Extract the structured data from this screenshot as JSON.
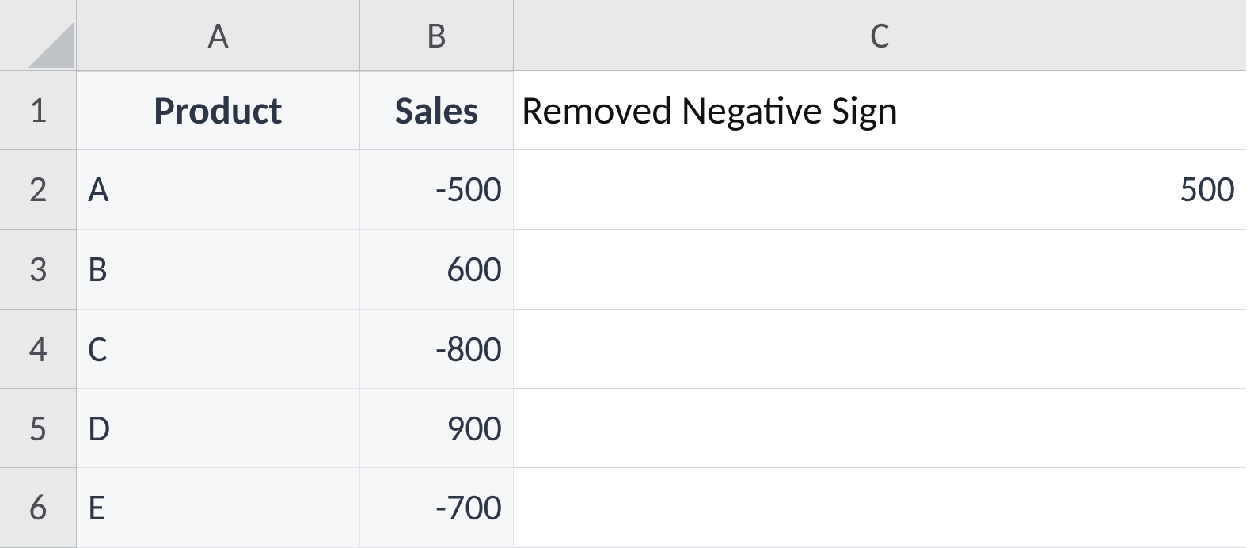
{
  "columns": [
    "A",
    "B",
    "C"
  ],
  "rows": [
    "1",
    "2",
    "3",
    "4",
    "5",
    "6"
  ],
  "table": {
    "headers": {
      "product": "Product",
      "sales": "Sales"
    },
    "rows": [
      {
        "product": "A",
        "sales": "-500"
      },
      {
        "product": "B",
        "sales": "600"
      },
      {
        "product": "C",
        "sales": "-800"
      },
      {
        "product": "D",
        "sales": "900"
      },
      {
        "product": "E",
        "sales": "-700"
      }
    ]
  },
  "colC": {
    "header": "Removed Negative Sign",
    "values": [
      "500",
      "",
      "",
      "",
      ""
    ]
  },
  "chart_data": {
    "type": "table",
    "columns": [
      "Product",
      "Sales",
      "Removed Negative Sign"
    ],
    "rows": [
      [
        "A",
        -500,
        500
      ],
      [
        "B",
        600,
        null
      ],
      [
        "C",
        -800,
        null
      ],
      [
        "D",
        900,
        null
      ],
      [
        "E",
        -700,
        null
      ]
    ]
  }
}
